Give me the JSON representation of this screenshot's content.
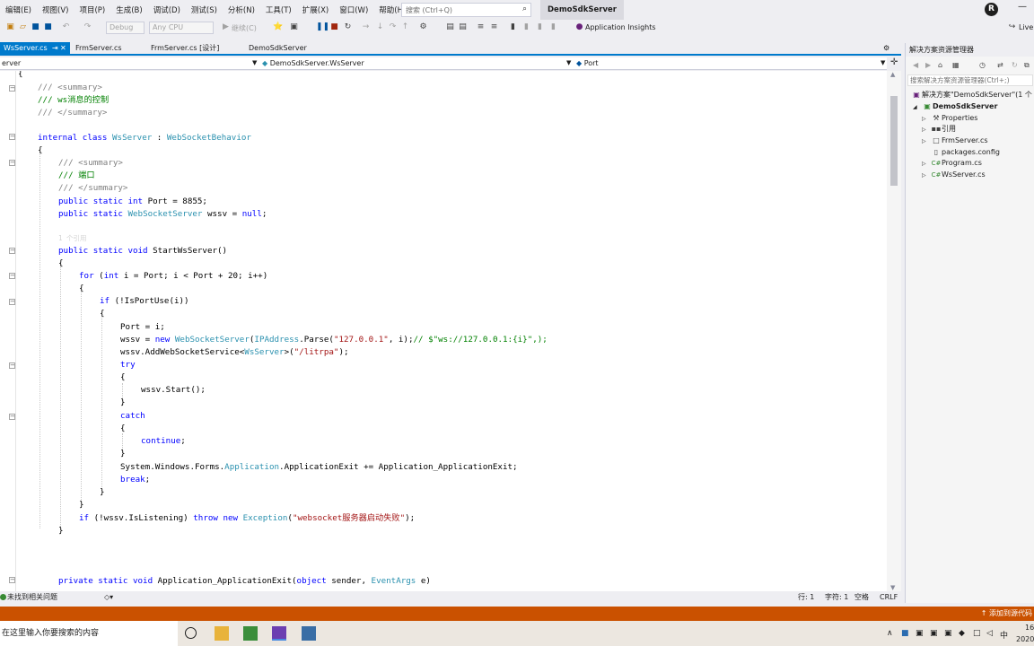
{
  "menu": [
    "编辑(E)",
    "视图(V)",
    "项目(P)",
    "生成(B)",
    "调试(D)",
    "测试(S)",
    "分析(N)",
    "工具(T)",
    "扩展(X)",
    "窗口(W)",
    "帮助(H)"
  ],
  "search": {
    "placeholder": "搜索 (Ctrl+Q)"
  },
  "solution_name": "DemoSdkServer",
  "user_initial": "R",
  "toolbar": {
    "config": "Debug",
    "platform": "Any CPU",
    "continue": "继续(C)",
    "app_insights": "Application Insights",
    "live_share": "Live"
  },
  "tabs": [
    {
      "label": "WsServer.cs",
      "active": true
    },
    {
      "label": "FrmServer.cs",
      "active": false
    },
    {
      "label": "FrmServer.cs [设计]",
      "active": false
    },
    {
      "label": "DemoSdkServer",
      "active": false
    }
  ],
  "nav": {
    "project": "erver",
    "class": "DemoSdkServer.WsServer",
    "member": "Port"
  },
  "code": {
    "l1": "/// <summary>",
    "l2": "/// ws消息的控制",
    "l3": "/// </summary>",
    "l4_kw": "internal class",
    "l4_name": "WsServer",
    "l4_base": "WebSocketBehavior",
    "l6": "/// <summary>",
    "l7": "/// 端口",
    "l8": "/// </summary>",
    "l9_kw": "public static int",
    "l9_rest": " Port = 8855;",
    "l10_kw": "public static",
    "l10_type": "WebSocketServer",
    "l10_rest": " wssv = ",
    "l10_null": "null",
    "l11": "1 个引用",
    "l12_kw": "public static void",
    "l12_rest": " StartWsServer()",
    "l14_for": "for",
    "l14_int": "int",
    "l14_rest": " i = Port; i < Port + 20; i++)",
    "l16_if": "if",
    "l16_rest": " (!IsPortUse(i))",
    "l18": "Port = i;",
    "l19_a": "wssv = ",
    "l19_new": "new",
    "l19_type": "WebSocketServer",
    "l19_b": "(",
    "l19_ip": "IPAddress",
    "l19_c": ".Parse(",
    "l19_str": "\"127.0.0.1\"",
    "l19_d": ", i);",
    "l19_cm": "// $\"ws://127.0.0.1:{i}\",);",
    "l20_a": "wssv.AddWebSocketService<",
    "l20_type": "WsServer",
    "l20_b": ">(",
    "l20_str": "\"/litrpa\"",
    "l20_c": ");",
    "l21": "try",
    "l23": "wssv.Start();",
    "l25": "catch",
    "l27": "continue",
    "l29_a": "System.Windows.Forms.",
    "l29_type": "Application",
    "l29_b": ".ApplicationExit += Application_ApplicationExit;",
    "l30": "break",
    "l33_if": "if",
    "l33_a": " (!wssv.IsListening) ",
    "l33_throw": "throw new",
    "l33_type": "Exception",
    "l33_str": "\"websocket服务器启动失败\"",
    "l35_kw": "private static void",
    "l35_a": " Application_ApplicationExit(",
    "l35_obj": "object",
    "l35_b": " sender, ",
    "l35_type": "EventArgs",
    "l35_c": " e)"
  },
  "panel": {
    "title": "解决方案资源管理器",
    "search_placeholder": "搜索解决方案资源管理器(Ctrl+;)",
    "tree": [
      {
        "label": "解决方案\"DemoSdkServer\"(1 个",
        "icon": "solution-icon"
      },
      {
        "label": "DemoSdkServer",
        "icon": "csharp-project-icon"
      },
      {
        "label": "Properties",
        "icon": "wrench-icon"
      },
      {
        "label": "引用",
        "icon": "references-icon"
      },
      {
        "label": "FrmServer.cs",
        "icon": "form-icon"
      },
      {
        "label": "packages.config",
        "icon": "file-icon"
      },
      {
        "label": "Program.cs",
        "icon": "csharp-file-icon"
      },
      {
        "label": "WsServer.cs",
        "icon": "csharp-file-icon"
      }
    ]
  },
  "editor_status": {
    "issues": "未找到相关问题",
    "line": "行: 1",
    "char": "字符: 1",
    "space": "空格",
    "crlf": "CRLF"
  },
  "statusbar": {
    "source_control": "添加到源代码"
  },
  "taskbar": {
    "search": "在这里输入你要搜索的内容",
    "ime": "中",
    "time": "16",
    "date": "2020"
  },
  "colors": {
    "accent": "#007acc",
    "status": "#ca5100"
  }
}
